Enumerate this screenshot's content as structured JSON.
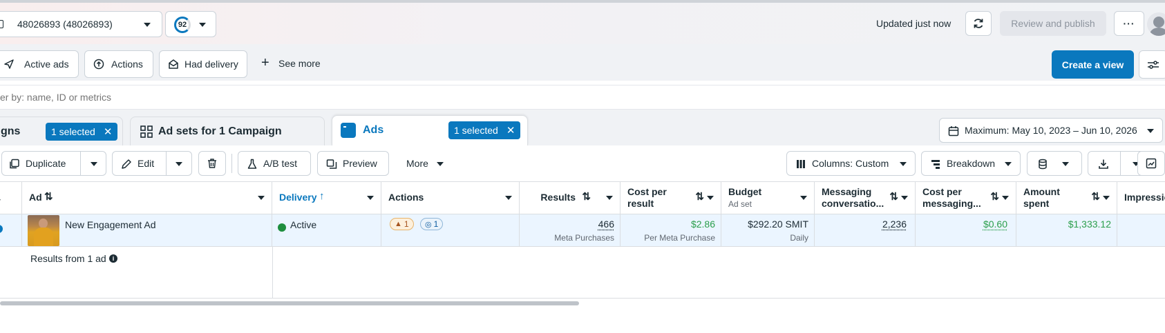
{
  "account": {
    "label": "48026893 (48026893)",
    "score": "92"
  },
  "header": {
    "updated": "Updated just now",
    "review_publish": "Review and publish"
  },
  "filters": {
    "active_ads": "Active ads",
    "actions": "Actions",
    "had_delivery": "Had delivery",
    "see_more": "See more",
    "create_view": "Create a view"
  },
  "search": {
    "placeholder": "er by: name, ID or metrics"
  },
  "tabs": {
    "campaigns": "gns",
    "campaigns_badge": "1 selected",
    "adsets": "Ad sets for 1 Campaign",
    "ads": "Ads",
    "ads_badge": "1 selected"
  },
  "date_range": "Maximum: May 10, 2023 – Jun 10, 2026",
  "toolbar": {
    "duplicate": "Duplicate",
    "edit": "Edit",
    "ab_test": "A/B test",
    "preview": "Preview",
    "more": "More",
    "columns": "Columns: Custom",
    "breakdown": "Breakdown"
  },
  "columns": {
    "ad": "Ad",
    "delivery": "Delivery",
    "actions": "Actions",
    "results": "Results",
    "cost_per_result_1": "Cost per",
    "cost_per_result_2": "result",
    "budget": "Budget",
    "budget_sub": "Ad set",
    "messaging_1": "Messaging",
    "messaging_2": "conversatio...",
    "cost_msg_1": "Cost per",
    "cost_msg_2": "messaging...",
    "amount_1": "Amount",
    "amount_2": "spent",
    "impressions": "Impressio"
  },
  "row": {
    "name": "New Engagement Ad",
    "delivery": "Active",
    "warn_count": "1",
    "action_count": "1",
    "results": "466",
    "results_sub": "Meta Purchases",
    "cost_per_result": "$2.86",
    "cost_per_result_sub": "Per Meta Purchase",
    "budget": "$292.20 SMIT",
    "budget_sub": "Daily",
    "messaging": "2,236",
    "cost_msg": "$0.60",
    "amount_spent": "$1,333.12"
  },
  "summary": {
    "label": "Results from 1 ad"
  },
  "colors": {
    "accent": "#0a78be",
    "green": "#2a9e4a",
    "active_dot": "#1e8e3e"
  }
}
